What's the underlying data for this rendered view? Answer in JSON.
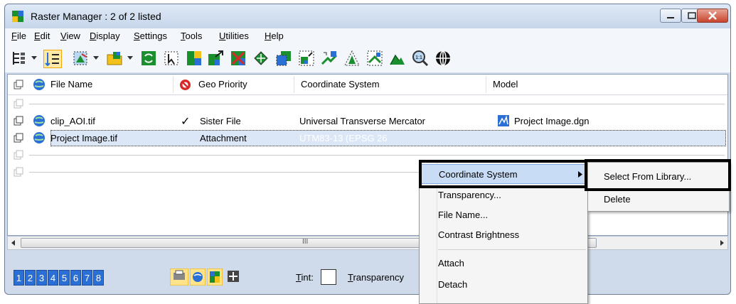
{
  "window": {
    "title": "Raster Manager : 2 of 2 listed"
  },
  "menubar": {
    "items": [
      "File",
      "Edit",
      "View",
      "Display",
      "Settings",
      "Tools",
      "Utilities",
      "Help"
    ]
  },
  "table": {
    "columns": [
      "File Name",
      "Geo Priority",
      "Coordinate System",
      "Model"
    ],
    "rows": [
      {
        "file_name": "",
        "check": "",
        "geo_priority": "",
        "coordinate_system": "",
        "model": ""
      },
      {
        "file_name": "clip_AOI.tif",
        "check": "✓",
        "geo_priority": "Sister File",
        "coordinate_system": "Universal Transverse Mercator",
        "model": "Project Image.dgn"
      },
      {
        "file_name": "Project Image.tif",
        "check": "",
        "geo_priority": "Attachment",
        "coordinate_system": "UTM83-13 (EPSG 26",
        "model": ""
      }
    ]
  },
  "scrollbar": {
    "grip": "III"
  },
  "bottom": {
    "numbers": [
      "1",
      "2",
      "3",
      "4",
      "5",
      "6",
      "7",
      "8"
    ],
    "tint_label": "Tint:",
    "transparency_label": "Transparency"
  },
  "context_menu": {
    "items": [
      "Coordinate System",
      "Transparency...",
      "File Name...",
      "Contrast Brightness",
      "Attach",
      "Detach"
    ]
  },
  "submenu": {
    "items": [
      "Select From Library...",
      "Delete"
    ]
  },
  "colors": {
    "accent": "#2a6fd6",
    "selection": "#dbe6f6",
    "menu_hover": "#c8dcf5"
  }
}
